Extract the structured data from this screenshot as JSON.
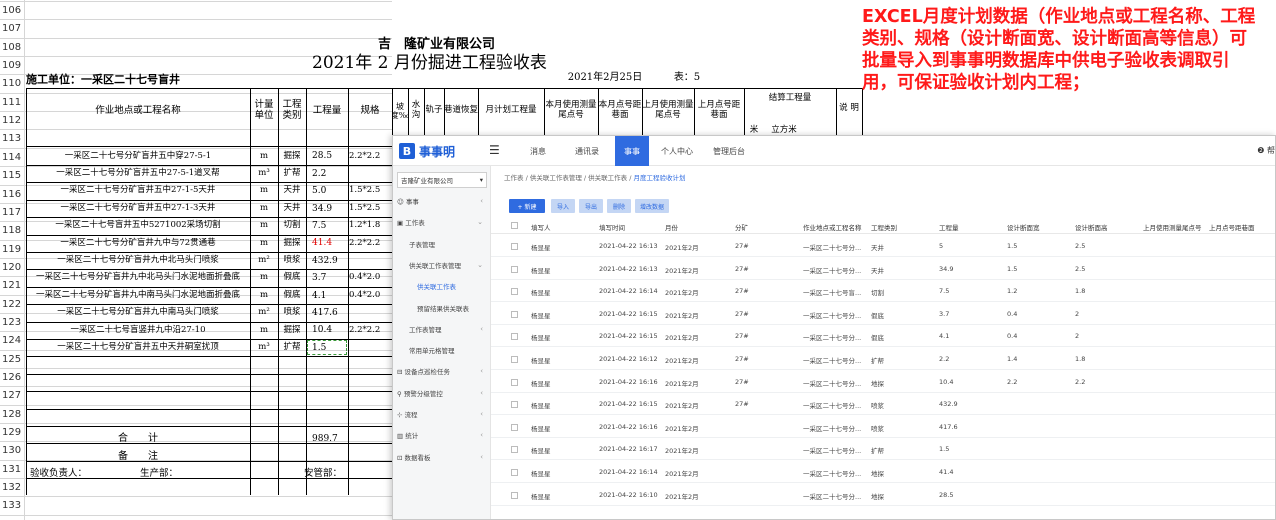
{
  "excel": {
    "row_numbers": [
      "106",
      "107",
      "108",
      "109",
      "110",
      "111",
      "112",
      "113",
      "114",
      "115",
      "116",
      "117",
      "118",
      "119",
      "120",
      "121",
      "122",
      "123",
      "124",
      "125",
      "126",
      "127",
      "128",
      "129",
      "130",
      "131",
      "132",
      "133"
    ],
    "company": "吉　隆矿业有限公司",
    "report_title": "2021年 2 月份掘进工程验收表",
    "unit_label": "施工单位：一采区二十七号盲井",
    "date": "2021年2月25日",
    "table_no": "表：5",
    "headers": {
      "location": "作业地点或工程名称",
      "unit": "计量单位",
      "type": "工程类别",
      "quantity": "工程量",
      "spec": "规格",
      "slope": "坡度‰",
      "ditch": "水沟",
      "rail": "轨子",
      "lane": "巷道恢复",
      "plan": "月计划工程量",
      "cur_point": "本月使用测量尾点号",
      "cur_dist": "本月点号距巷面",
      "last_point": "上月使用测量尾点号",
      "last_dist": "上月点号距巷面",
      "settle": "结算工程量",
      "meter": "米",
      "cubic": "立方米",
      "remark": "说 明"
    },
    "rows": [
      {
        "name": "一采区二十七号分矿盲井五中穿27-5-1",
        "unit": "m",
        "type": "掘探",
        "qty": "28.5",
        "spec": "2.2*2.2",
        "qty_red": false
      },
      {
        "name": "一采区二十七号分矿盲井五中27-5-1道叉帮",
        "unit": "m³",
        "type": "扩帮",
        "qty": "2.2",
        "spec": "",
        "qty_red": false
      },
      {
        "name": "一采区二十七号分矿盲井五中27-1-5天井",
        "unit": "m",
        "type": "天井",
        "qty": "5.0",
        "spec": "1.5*2.5",
        "qty_red": false
      },
      {
        "name": "一采区二十七号分矿盲井五中27-1-3天井",
        "unit": "m",
        "type": "天井",
        "qty": "34.9",
        "spec": "1.5*2.5",
        "qty_red": false
      },
      {
        "name": "一采区二十七号盲井五中5271002采场切割",
        "unit": "m",
        "type": "切割",
        "qty": "7.5",
        "spec": "1.2*1.8",
        "qty_red": false
      },
      {
        "name": "一采区二十七号分矿盲井九中与72贯通巷",
        "unit": "m",
        "type": "掘探",
        "qty": "41.4",
        "spec": "2.2*2.2",
        "qty_red": true
      },
      {
        "name": "一采区二十七号分矿盲井九中北马头门喷浆",
        "unit": "m²",
        "type": "喷浆",
        "qty": "432.9",
        "spec": "",
        "qty_red": false
      },
      {
        "name": "一采区二十七号分矿盲井九中北马头门水泥地面折叠底",
        "unit": "m",
        "type": "假底",
        "qty": "3.7",
        "spec": "0.4*2.0",
        "qty_red": false
      },
      {
        "name": "一采区二十七号分矿盲井九中南马头门水泥地面折叠底",
        "unit": "m",
        "type": "假底",
        "qty": "4.1",
        "spec": "0.4*2.0",
        "qty_red": false
      },
      {
        "name": "一采区二十七号分矿盲井九中南马头门喷浆",
        "unit": "m²",
        "type": "喷浆",
        "qty": "417.6",
        "spec": "",
        "qty_red": false
      },
      {
        "name": "一采区二十七号盲竖井九中沿27-10",
        "unit": "m",
        "type": "掘探",
        "qty": "10.4",
        "spec": "2.2*2.2",
        "qty_red": false
      },
      {
        "name": "一采区二十七号分矿盲井五中天井硐室扰顶",
        "unit": "m³",
        "type": "扩帮",
        "qty": "1.5",
        "spec": "",
        "qty_red": false
      }
    ],
    "total_label": "合　　计",
    "total_value": "989.7",
    "remark_label": "备　　注",
    "sign_accept": "验收负责人：",
    "sign_production": "生产部：",
    "sign_safety": "安管部："
  },
  "annotation": "EXCEL月度计划数据（作业地点或工程名称、工程类别、规格（设计断面宽、设计断面高等信息）可批量导入到事事明数据库中供电子验收表调取引用，可保证验收计划内工程；",
  "app": {
    "logo": "事事明",
    "logo_mark": "B",
    "menu_icon": "☰",
    "nav": [
      "消息",
      "通讯录",
      "事事",
      "个人中心",
      "管理后台"
    ],
    "nav_active": "事事",
    "help": "❷ 帮",
    "org": "吉隆矿业有限公司",
    "sidebar": [
      {
        "label": "☺ 事事",
        "chev": "‹",
        "level": 0
      },
      {
        "label": "▣ 工作表",
        "chev": "⌄",
        "level": 0
      },
      {
        "label": "子表管理",
        "chev": "",
        "level": 1
      },
      {
        "label": "供关联工作表管理",
        "chev": "⌄",
        "level": 1
      },
      {
        "label": "供关联工作表",
        "chev": "",
        "level": 2,
        "active": true
      },
      {
        "label": "预留结果供关联表",
        "chev": "",
        "level": 2
      },
      {
        "label": "工作表管理",
        "chev": "‹",
        "level": 1
      },
      {
        "label": "常用单元格管理",
        "chev": "",
        "level": 1
      },
      {
        "label": "⊟ 设备点巡检任务",
        "chev": "‹",
        "level": 0
      },
      {
        "label": "⚲ 预警分级管控",
        "chev": "‹",
        "level": 0
      },
      {
        "label": "⊹ 流程",
        "chev": "‹",
        "level": 0
      },
      {
        "label": "▥ 统计",
        "chev": "‹",
        "level": 0
      },
      {
        "label": "⊡ 数据看板",
        "chev": "‹",
        "level": 0
      }
    ],
    "breadcrumb": [
      "工作表",
      "供关联工作表管理",
      "供关联工作表",
      "月度工程验收计划"
    ],
    "buttons": [
      "+ 新建",
      "导入",
      "导出",
      "删除",
      "增改数据"
    ],
    "columns": [
      "填写人",
      "填写时间",
      "月份",
      "分矿",
      "作业地点或工程名称",
      "工程类别",
      "工程量",
      "设计断面宽",
      "设计断面高",
      "上月使用测量尾点号",
      "上月点号距巷面"
    ],
    "rows": [
      [
        "杨显星",
        "2021-04-22 16:13",
        "2021年2月",
        "27#",
        "一采区二十七号分...",
        "天井",
        "5",
        "1.5",
        "2.5"
      ],
      [
        "杨显星",
        "2021-04-22 16:13",
        "2021年2月",
        "27#",
        "一采区二十七号分...",
        "天井",
        "34.9",
        "1.5",
        "2.5"
      ],
      [
        "杨显星",
        "2021-04-22 16:14",
        "2021年2月",
        "27#",
        "一采区二十七号盲...",
        "切割",
        "7.5",
        "1.2",
        "1.8"
      ],
      [
        "杨显星",
        "2021-04-22 16:15",
        "2021年2月",
        "27#",
        "一采区二十七号分...",
        "假底",
        "3.7",
        "0.4",
        "2"
      ],
      [
        "杨显星",
        "2021-04-22 16:15",
        "2021年2月",
        "27#",
        "一采区二十七号分...",
        "假底",
        "4.1",
        "0.4",
        "2"
      ],
      [
        "杨显星",
        "2021-04-22 16:12",
        "2021年2月",
        "27#",
        "一采区二十七号分...",
        "扩帮",
        "2.2",
        "1.4",
        "1.8"
      ],
      [
        "杨显星",
        "2021-04-22 16:16",
        "2021年2月",
        "27#",
        "一采区二十七号分...",
        "地探",
        "10.4",
        "2.2",
        "2.2"
      ],
      [
        "杨显星",
        "2021-04-22 16:15",
        "2021年2月",
        "27#",
        "一采区二十七号分...",
        "喷浆",
        "432.9",
        "",
        ""
      ],
      [
        "杨显星",
        "2021-04-22 16:16",
        "2021年2月",
        "",
        "一采区二十七号分...",
        "喷浆",
        "417.6",
        "",
        ""
      ],
      [
        "杨显星",
        "2021-04-22 16:17",
        "2021年2月",
        "",
        "一采区二十七号分...",
        "扩帮",
        "1.5",
        "",
        ""
      ],
      [
        "杨显星",
        "2021-04-22 16:14",
        "2021年2月",
        "",
        "一采区二十七号分...",
        "地探",
        "41.4",
        "",
        ""
      ],
      [
        "杨显星",
        "2021-04-22 16:10",
        "2021年2月",
        "",
        "一采区二十七号分...",
        "地探",
        "28.5",
        "",
        ""
      ]
    ]
  }
}
